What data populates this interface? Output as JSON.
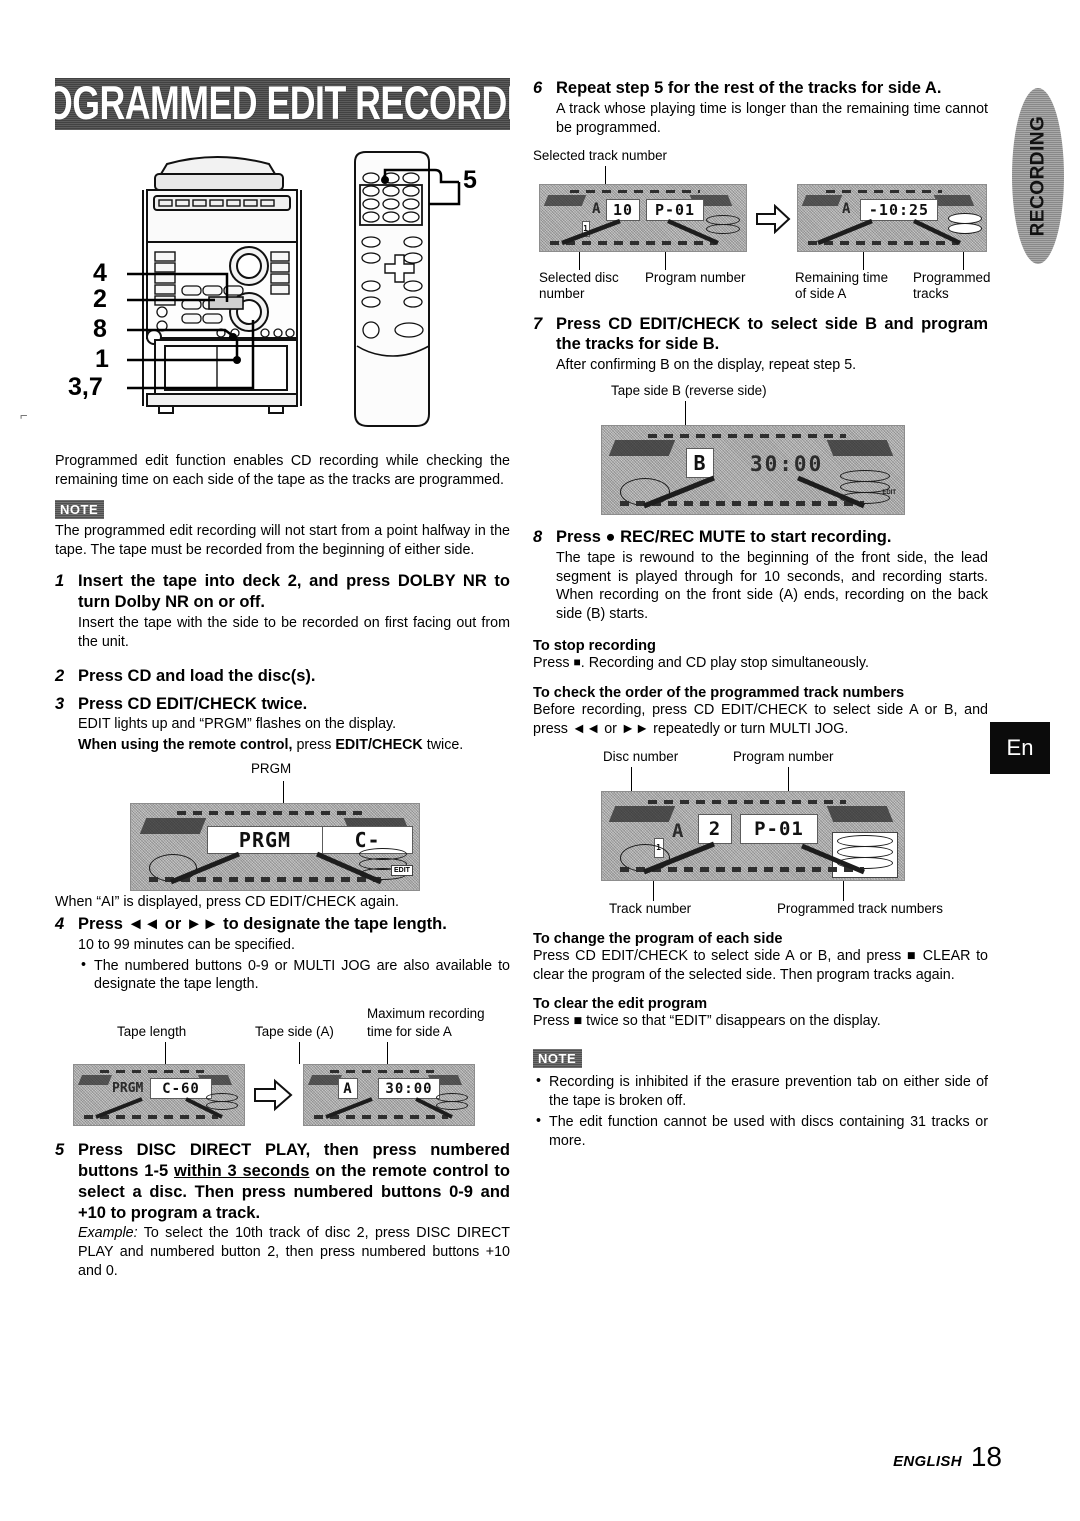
{
  "banner": {
    "title": "PROGRAMMED EDIT RECORDING"
  },
  "side_tab": {
    "label": "RECORDING"
  },
  "language_badge": {
    "label": "En"
  },
  "footer": {
    "language": "ENGLISH",
    "page_number": "18"
  },
  "hardware_figure": {
    "callouts": [
      "4",
      "2",
      "8",
      "1",
      "3,7",
      "5"
    ],
    "devices": [
      "mini-system",
      "remote-control"
    ]
  },
  "intro": {
    "text": "Programmed edit function enables CD recording while checking the remaining time on each side of the tape as the tracks are programmed."
  },
  "note_top": {
    "tag": "NOTE",
    "text": "The programmed edit recording will not start from a point halfway in the tape. The tape must be recorded from the beginning of either side."
  },
  "steps": [
    {
      "num": "1",
      "title": "Insert the tape into deck 2, and press DOLBY NR to turn Dolby NR on or off.",
      "body": "Insert the tape with the side to be recorded on first facing out from the unit."
    },
    {
      "num": "2",
      "title": "Press CD and load the disc(s).",
      "body": ""
    },
    {
      "num": "3",
      "title": "Press CD EDIT/CHECK twice.",
      "body_line1": "EDIT lights up and “PRGM” flashes on the display.",
      "body_line2_bold": "When using the remote control,",
      "body_line2_rest": " press ",
      "body_line2_bold2": "EDIT/CHECK",
      "body_line2_tail": " twice.",
      "after_figure": "When “AI” is displayed, press CD EDIT/CHECK again."
    },
    {
      "num": "4",
      "title": "Press ◄◄ or ►► to designate the tape length.",
      "body": "10 to 99 minutes can be specified.",
      "bullet": "The numbered buttons 0-9 or MULTI JOG are also available to designate the tape length."
    },
    {
      "num": "5",
      "title_p1": "Press DISC DIRECT PLAY, then press numbered buttons 1-5 ",
      "title_underline": "within 3 seconds",
      "title_p2": " on the remote control to select a disc. Then press numbered buttons 0-9 and +10 to program a track.",
      "example_label": "Example:",
      "example_text": " To select the 10th track of disc 2, press DISC DIRECT PLAY and numbered button 2, then press numbered buttons +10 and 0."
    },
    {
      "num": "6",
      "title": "Repeat step 5 for the rest of the tracks for side A.",
      "body": "A track whose playing time is longer than the remaining time cannot be programmed."
    },
    {
      "num": "7",
      "title": "Press CD EDIT/CHECK to select side B and program the tracks for side B.",
      "body": "After confirming B on the display, repeat step 5."
    },
    {
      "num": "8",
      "title": "Press ● REC/REC MUTE to start recording.",
      "body": "The tape is rewound to the beginning of the front side, the lead segment is played through for 10 seconds, and recording starts. When recording on the front side (A) ends, recording on the back side (B) starts."
    }
  ],
  "figure_step3": {
    "top_label": "PRGM",
    "display": {
      "left_text": "PRGM",
      "main_text": "C-",
      "flashing": "**",
      "edit_indicator": "EDIT"
    }
  },
  "figure_step4": {
    "labels": {
      "tape_length": "Tape length",
      "tape_side": "Tape side (A)",
      "max_time_l1": "Maximum recording",
      "max_time_l2": "time for side A"
    },
    "display_left": {
      "prefix": "PRGM",
      "value": "C-60"
    },
    "display_right": {
      "side": "A",
      "value": "30:00"
    }
  },
  "figure_step6": {
    "labels": {
      "selected_track": "Selected track number",
      "selected_disc_l1": "Selected disc",
      "selected_disc_l2": "number",
      "program_number": "Program number",
      "remaining_l1": "Remaining time",
      "remaining_l2": "of side A",
      "programmed_l1": "Programmed",
      "programmed_l2": "tracks"
    },
    "display_left": {
      "side": "A",
      "track": "10",
      "program": "P-01"
    },
    "display_right": {
      "side": "A",
      "remaining": "-10:25"
    }
  },
  "figure_step7": {
    "label": "Tape side B (reverse side)",
    "display": {
      "side": "B",
      "value": "30:00"
    }
  },
  "figure_check": {
    "labels": {
      "disc_number": "Disc number",
      "program_number": "Program number",
      "track_number": "Track number",
      "programmed_tracks": "Programmed track numbers"
    },
    "display": {
      "side": "A",
      "disc": "2",
      "program": "P-01"
    }
  },
  "sections": [
    {
      "heading": "To stop recording",
      "lines": [
        {
          "pre": "Press ",
          "sq": "■",
          "post": ". Recording and CD play stop simultaneously."
        }
      ]
    },
    {
      "heading": "To check the order of the programmed track numbers",
      "text": "Before recording, press CD EDIT/CHECK to select side A or B, and press ◄◄ or ►► repeatedly or turn MULTI JOG."
    },
    {
      "heading": "To change the program of each side",
      "text": "Press CD EDIT/CHECK to select side A or B, and press ■ CLEAR to clear the program of the selected side. Then program tracks again."
    },
    {
      "heading": "To clear the edit program",
      "text": "Press ■ twice so that “EDIT” disappears on the display."
    }
  ],
  "note_bottom": {
    "tag": "NOTE",
    "bullets": [
      "Recording is inhibited if the erasure prevention tab on either side of the tape is broken off.",
      "The edit function cannot be used with discs containing 31 tracks or more."
    ]
  }
}
